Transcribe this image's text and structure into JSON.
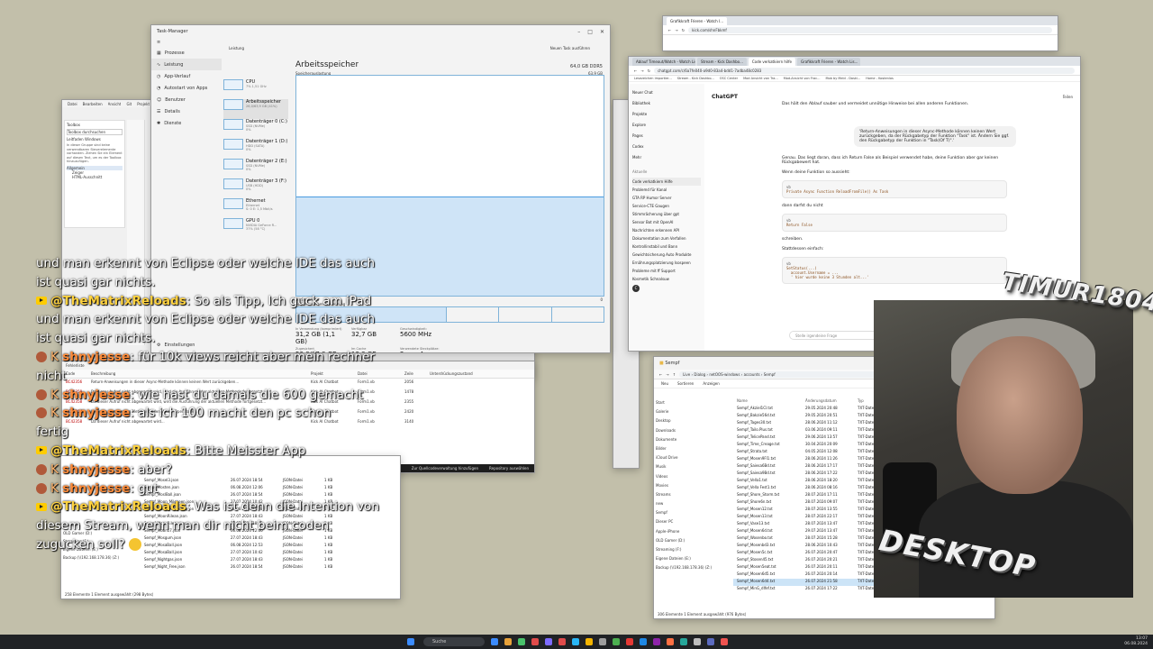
{
  "task_manager": {
    "title": "Task-Manager",
    "nav": [
      "Prozesse",
      "Leistung",
      "App-Verlauf",
      "Autostart von Apps",
      "Benutzer",
      "Details",
      "Dienste"
    ],
    "nav_footer": "Einstellungen",
    "header_tab": "Leistung",
    "run_task": "Neuen Task ausführen",
    "perf_items": [
      {
        "name": "CPU",
        "sub": "7% 1,51 GHz"
      },
      {
        "name": "Arbeitsspeicher",
        "sub": "26,0/63,9 GB (41%)"
      },
      {
        "name": "Datenträger 0 (C:)",
        "sub": "SSD (NVMe)\n0%"
      },
      {
        "name": "Datenträger 1 (D:)",
        "sub": "HDD (SATA)\n0%"
      },
      {
        "name": "Datenträger 2 (E:)",
        "sub": "SSD (NVMe)\n0%"
      },
      {
        "name": "Datenträger 3 (F:)",
        "sub": "USB (HDD)\n0%"
      },
      {
        "name": "Ethernet",
        "sub": "Ethernet\nS: 0 E: 1,5 Mbit/s"
      },
      {
        "name": "GPU 0",
        "sub": "NVIDIA GeForce R...\n37% (58 °C)"
      }
    ],
    "section_title": "Arbeitsspeicher",
    "capacity": "64,0 GB DDR5",
    "chart_label": "Speicherauslastung",
    "chart_max": "63,9 GB",
    "chart_axis_left": "60 Sekunden",
    "chart_axis_right": "0",
    "composition_label": "Speicherzusammensetzung",
    "stats": [
      {
        "label": "In Verwendung (komprimiert)",
        "value": "31,2 GB (1,1 GB)"
      },
      {
        "label": "Verfügbar",
        "value": "32,7 GB"
      },
      {
        "label": "Geschwindigkeit:",
        "value": "5600 MHz"
      },
      {
        "label": "Zugesichert",
        "value": "53,8/87,9 GB"
      },
      {
        "label": "Im Cache",
        "value": "13,3 GB"
      },
      {
        "label": "Verwendete Steckplätze:",
        "value": "2 von 4"
      },
      {
        "label": "Ausgelagerter Pool",
        "value": "1,2 GB"
      },
      {
        "label": "Nicht ausgelagerter Pool",
        "value": "1,2 GB"
      },
      {
        "label": "Hardwarereserviert:",
        "value": "103 MB"
      }
    ],
    "memory_usage_fraction": 0.45
  },
  "chat_overlay": [
    {
      "type": "text",
      "text": "und man erkennt von Eclipse oder welche IDE das auch"
    },
    {
      "type": "text",
      "text": "ist quasi gar nichts."
    },
    {
      "type": "yt",
      "user": "@TheMatrixReloads",
      "text": "So als Tipp, Ich guck am iPad"
    },
    {
      "type": "text",
      "text": "und man erkennt von Eclipse oder welche IDE das auch"
    },
    {
      "type": "text",
      "text": "ist quasi gar nichts."
    },
    {
      "type": "kick",
      "user": "shnyjesse",
      "text": "für 10k views reicht aber mein rechner"
    },
    {
      "type": "text",
      "text": "nicht"
    },
    {
      "type": "kick",
      "user": "shnyjesse",
      "text": "wie hast du damals die 600 gemacht"
    },
    {
      "type": "kick",
      "user": "shnyjesse",
      "text": "als ich 100 macht den pc schon"
    },
    {
      "type": "text",
      "text": "fertig"
    },
    {
      "type": "yt",
      "user": "@TheMatrixReloads",
      "text": "Bitte Meisster App"
    },
    {
      "type": "kick",
      "user": "shnyjesse",
      "text": "aber?"
    },
    {
      "type": "kick",
      "user": "shnyjesse",
      "text": "gut"
    },
    {
      "type": "yt",
      "user": "@TheMatrixReloads",
      "text": "Was ist denn die Intention von"
    },
    {
      "type": "text",
      "text": "diesem Stream, wenn man dir nicht beim coden"
    },
    {
      "type": "text",
      "text": "zugucken soll?"
    }
  ],
  "chrome_small": {
    "tab": "Grafikkraft Frieren - Watch I...",
    "url": "kick.com/shnFbkmf"
  },
  "chatgpt": {
    "tabs": [
      "Ablauf Timeout/Watch - Watch Lis...",
      "Stream - Kick Dashbo...",
      "Code verkatkiern hilfe",
      "Grafikkraft Frieren - Watch Lis..."
    ],
    "url": "chatgpt.com/c/6a7fe040-a9d0-83a4-bdd1-7adba48c0283",
    "bookmarks": [
      "Lesezeichen importier...",
      "Stream - Kick Dashbo...",
      "OSC Center",
      "Mod Ansicht von Tra...",
      "Mod-Ansicht von Frac...",
      "Mob by Meld - Daski...",
      "Home - Kostenlos"
    ],
    "app": "ChatGPT",
    "share": "Teilen",
    "side_items": [
      "Neuer Chat",
      "Bibliothek",
      "Projekte",
      "Explore",
      "Pages",
      "Codex",
      "Mehr"
    ],
    "side_section": "Aktuelle",
    "recent": [
      "Code verkatkiern Hilfe",
      "Problemd für Kanal",
      "GTA RP Humor Server",
      "Service-CTE Gaugen",
      "Stimmrächerung über gpt",
      "Sensor Bot mit OpenAI",
      "Nachrichten erkennen API",
      "Dokumentation zum Verfallen",
      "Kontrollinstabil und Bann",
      "Gewichtsicherung Auto Produkte",
      "Ernährungsplatzierung Isospeen",
      "Probleme mit ff Support",
      "Kosmetik Schnalsuw"
    ],
    "user": "C",
    "intro": "Das hält den Ablauf sauber und vermeidet unnötige Hinweise bei allen anderen Funktionen.",
    "bubble": "'Return-Anweisungen in dieser Async-Methode können keinen Wert zurückgeben, da der Rückgabetyp der Funktion \"Task\" ist. Ändern Sie ggf. den Rückgabetyp der Funktion in \"Task(Of T)\".'",
    "p1": "Genau. Das liegt daran, dass ich Return False als Beispiel verwendet habe, deine Funktion aber gar keinen Rückgabewert hat.",
    "p2": "Wenn deine Funktion so aussieht:",
    "code1_lang": "vb",
    "code1": "Private Async Function ReloadFromFile() As Task",
    "p3": "dann darfst du nicht",
    "code2_lang": "vb",
    "code2": "Return False",
    "p4": "schreiben.",
    "p5": "Stattdessen einfach:",
    "code3_lang": "vb",
    "code3": "SetStatus(...)\n  account.Username = ...\n  ' hier wurde keine 3 Stunden alt...' ",
    "input_placeholder": "Stelle irgendeine Frage"
  },
  "explorer_right": {
    "title": "Sempf",
    "path": [
      "Live",
      "Dialog",
      "netOOS-windows",
      "accounts",
      "Sempf"
    ],
    "search": "Sempf durchsuchen",
    "new": "Neu",
    "sort": "Sortieren",
    "view": "Anzeigen",
    "columns": [
      "Name",
      "Änderungsdatum",
      "Typ"
    ],
    "nav": [
      "Start",
      "Galerie",
      "Desktop",
      "Downloads",
      "Dokumente",
      "Bilder",
      "iCloud Drive",
      "Musik",
      "Videos",
      "Movies",
      "Streams",
      "new",
      "Sempf",
      "Dieser PC",
      "Apple-iPhone",
      "OLD Gamer (D:)",
      "Streaming (F:)",
      "Eigene Dateien (E:)",
      "Backup (\\\\192.168.178.36) (Z:)"
    ],
    "files": [
      {
        "name": "Sempf_Akziel1Cl.txt",
        "date": "29.05.2024 20:48",
        "type": "TXT-Datei"
      },
      {
        "name": "Sempf_Bakzie56d.txt",
        "date": "29.05.2024 20:51",
        "type": "TXT-Datei"
      },
      {
        "name": "Sempf_Tages30.txt",
        "date": "28.06.2024 11:12",
        "type": "TXT-Datei"
      },
      {
        "name": "Sempf_Tailo.Plus.txt",
        "date": "03.06.2024 09:11",
        "type": "TXT-Datei"
      },
      {
        "name": "Sempf_TelicePand.txt",
        "date": "29.06.2024 13:57",
        "type": "TXT-Datei"
      },
      {
        "name": "Sempf_Time_Creage.txt",
        "date": "30.04.2024 20:09",
        "type": "TXT-Datei"
      },
      {
        "name": "Sempf_Strata.txt",
        "date": "04.05.2024 12:08",
        "type": "TXT-Datei"
      },
      {
        "name": "Sempf_Mosen9Fl1.txt",
        "date": "28.06.2024 11:26",
        "type": "TXT-Datei"
      },
      {
        "name": "Sempf_Saiesa6Bd.txt",
        "date": "28.06.2024 17:17",
        "type": "TXT-Datei"
      },
      {
        "name": "Sempf_Saiesa9Bd.txt",
        "date": "28.06.2024 17:22",
        "type": "TXT-Datei"
      },
      {
        "name": "Sempf_Vella1.txt",
        "date": "28.06.2024 18:20",
        "type": "TXT-Datei"
      },
      {
        "name": "Sempf_Vella Fest1.txt",
        "date": "28.06.2024 08:16",
        "type": "TXT-Datei"
      },
      {
        "name": "Sempf_Shore_Storm.txt",
        "date": "28.07.2024 17:11",
        "type": "TXT-Datei"
      },
      {
        "name": "Sempf_Shore6n.txt",
        "date": "28.07.2024 09:07",
        "type": "TXT-Datei"
      },
      {
        "name": "Sempf_Mosen12.txt",
        "date": "28.07.2024 13:55",
        "type": "TXT-Datei"
      },
      {
        "name": "Sempf_Mosen13.txt",
        "date": "28.07.2024 22:17",
        "type": "TXT-Datei"
      },
      {
        "name": "Sempf_Vase13.txt",
        "date": "28.07.2024 13:47",
        "type": "TXT-Datei"
      },
      {
        "name": "Sempf_Mosen6d.txt",
        "date": "29.07.2024 13:47",
        "type": "TXT-Datei"
      },
      {
        "name": "Sempf_Wosenbo.txt",
        "date": "28.07.2024 15:28",
        "type": "TXT-Datei"
      },
      {
        "name": "Sempf_Mosenbd3.txt",
        "date": "28.06.2024 10:43",
        "type": "TXT-Datei"
      },
      {
        "name": "Sempf_Mosen5c.txt",
        "date": "26.07.2024 20:47",
        "type": "TXT-Datei"
      },
      {
        "name": "Sempf_Stosen45.txt",
        "date": "26.07.2024 20:21",
        "type": "TXT-Datei"
      },
      {
        "name": "Sempf_Mosen5eat.txt",
        "date": "26.07.2024 20:11",
        "type": "TXT-Datei"
      },
      {
        "name": "Sempf_Mosen6d5.txt",
        "date": "26.07.2024 20:14",
        "type": "TXT-Datei"
      },
      {
        "name": "Sempf_Mosen6d4.txt",
        "date": "26.07.2024 21:58",
        "type": "TXT-Datei"
      },
      {
        "name": "Sempf_MinG_dlfef.txt",
        "date": "26.07.2024 17:22",
        "type": "TXT-Datei"
      }
    ],
    "status": "306 Elemente    1 Element ausgewählt (976 Bytes)"
  },
  "explorer_left": {
    "files": [
      {
        "name": "Sempf_Mosel3.json",
        "date": "26.07.2024 18:54",
        "type": "JSON-Datei",
        "size": "1 KB"
      },
      {
        "name": "Sempf_Mosten.json",
        "date": "06.08.2024 12:06",
        "type": "JSON-Datei",
        "size": "1 KB"
      },
      {
        "name": "Sempf_MoslBall.json",
        "date": "26.07.2024 18:54",
        "type": "JSON-Datei",
        "size": "1 KB"
      },
      {
        "name": "Sempf_Moon_Mileyeen.json",
        "date": "27.07.2024 10:42",
        "type": "JSON-Datei",
        "size": "1 KB"
      },
      {
        "name": "Sempf_Moon_Mileyeen.json",
        "date": "29.08.2024 10:28",
        "type": "JSON-Datei",
        "size": "1 KB"
      },
      {
        "name": "Sempf_MoonRilean.json",
        "date": "27.07.2024 18:43",
        "type": "JSON-Datei",
        "size": "1 KB"
      },
      {
        "name": "Sempf_MoonRilean.json",
        "date": "27.07.2024 18:43",
        "type": "JSON-Datei",
        "size": "1 KB"
      },
      {
        "name": "Sempf_Moon17.json",
        "date": "06.08.2024 12:06",
        "type": "JSON-Datei",
        "size": "1 KB"
      },
      {
        "name": "Sempf_Mosgum.json",
        "date": "27.07.2024 18:43",
        "type": "JSON-Datei",
        "size": "1 KB"
      },
      {
        "name": "Sempf_MosaBall.json",
        "date": "06.08.2024 12:53",
        "type": "JSON-Datei",
        "size": "1 KB"
      },
      {
        "name": "Sempf_MosaBall.json",
        "date": "27.07.2024 10:42",
        "type": "JSON-Datei",
        "size": "1 KB"
      },
      {
        "name": "Sempf_Nightgas.json",
        "date": "27.07.2024 18:43",
        "type": "JSON-Datei",
        "size": "1 KB"
      },
      {
        "name": "Sempf_Night_Free.json",
        "date": "26.07.2024 18:54",
        "type": "JSON-Datei",
        "size": "1 KB"
      }
    ],
    "nav": [
      "Dieser PC",
      "OLD Gamer (D:)",
      "Streaming (F:)",
      "Eigene Dateien (E:)",
      "Backup (\\\\192.168.178.36) (Z:)"
    ],
    "status": "258 Elemente    1 Element ausgewählt (298 Bytes)"
  },
  "ide": {
    "menu": [
      "Datei",
      "Bearbeiten",
      "Ansicht",
      "Git",
      "Projekt"
    ],
    "toolbox_title": "Toolbox",
    "toolbox_search": "Toolbox durchsuchen",
    "toolbox_group": "Leitfaden Windows",
    "toolbox_empty": "In dieser Gruppe sind keine verwendbaren Steuerelemente vorhanden. Ziehen Sie ein Element auf diesen Text, um es der Toolbox hinzuzufügen.",
    "toolbox_items": [
      "Allgemein",
      "Zeiger",
      "HTML-Ausschnitt"
    ],
    "status": "Zeile: 2066  Zeichen: 21  SPC  CRLF",
    "encoding": "UTF-8 ohne BOM",
    "errors_title": "Fehlerliste",
    "errors_cols": [
      "Code",
      "Beschreibung",
      "Projekt",
      "Datei",
      "Zeile",
      "Unterdrückungszustand"
    ],
    "errors": [
      {
        "code": "BC42356",
        "desc": "Return-Anweisungen in dieser Async-Methode können keinen Wert zurückgeben...",
        "project": "Kick AI Chatbot",
        "file": "Form1.vb",
        "line": "2056"
      },
      {
        "code": "BC42358",
        "desc": "Da dieser Aufruf nicht abgewartet wird, wird die Ausführung der aktuellen Methode fortgesetzt...",
        "project": "Kick AI Chatbot",
        "file": "Form1.vb",
        "line": "1478"
      },
      {
        "code": "BC42358",
        "desc": "Da dieser Aufruf nicht abgewartet wird, wird die Ausführung der aktuellen Methode fortgesetzt...",
        "project": "Kick AI Chatbot",
        "file": "Form1.vb",
        "line": "2355"
      },
      {
        "code": "BC42358",
        "desc": "In dieser asynchronen Methode fehlen 'Await'-Operatoren...",
        "project": "Kick AI Chatbot",
        "file": "Form1.vb",
        "line": "2420"
      },
      {
        "code": "BC42358",
        "desc": "Da dieser Aufruf nicht abgewartet wird...",
        "project": "Kick AI Chatbot",
        "file": "Form1.vb",
        "line": "3140"
      }
    ],
    "bottom_left": "Zur Quellcodeverwaltung hinzufügen",
    "bottom_right": "Repository auswählen"
  },
  "overlay_logo_top": "TIMUR1804",
  "overlay_logo_bottom": "DESKTOP",
  "taskbar": {
    "search": "Suche",
    "time": "13:07",
    "date": "06.08.2024",
    "icon_colors": [
      "#3c8cff",
      "#e8a23a",
      "#49c26b",
      "#e04b4b",
      "#7d6bff",
      "#e04b4b",
      "#29b6f6",
      "#f4b400",
      "#9e9e9e",
      "#4caf50",
      "#e53935",
      "#1e88e5",
      "#8e24aa",
      "#ff7043",
      "#26a69a",
      "#bdbdbd",
      "#5c6bc0",
      "#ef5350"
    ]
  }
}
